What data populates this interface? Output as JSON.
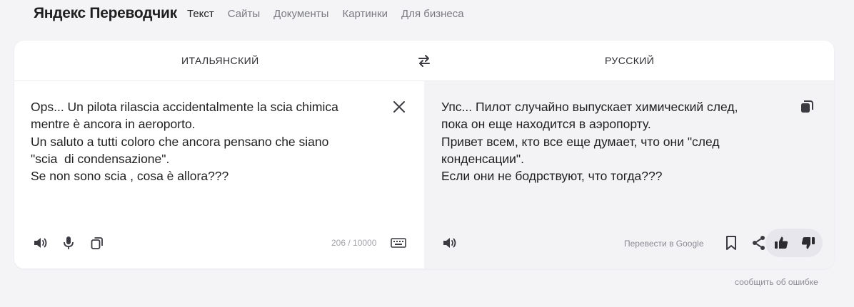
{
  "header": {
    "logo": "Яндекс Переводчик",
    "nav": [
      {
        "label": "Текст",
        "active": true
      },
      {
        "label": "Сайты",
        "active": false
      },
      {
        "label": "Документы",
        "active": false
      },
      {
        "label": "Картинки",
        "active": false
      },
      {
        "label": "Для бизнеса",
        "active": false
      }
    ]
  },
  "languages": {
    "source": "ИТАЛЬЯНСКИЙ",
    "target": "РУССКИЙ",
    "swap_icon": "swap-arrows-icon"
  },
  "source": {
    "text": "Ops... Un pilota rilascia accidentalmente la scia chimica\nmentre è ancora in aeroporto.\nUn saluto a tutti coloro che ancora pensano che siano\n\"scia  di condensazione\".\nSe non sono scia , cosa è allora???",
    "counter": "206 / 10000",
    "icons": [
      "close-icon",
      "speaker-icon",
      "microphone-icon",
      "copy-icon",
      "keyboard-icon"
    ]
  },
  "target": {
    "text": "Упс... Пилот случайно выпускает химический след,\nпока он еще находится в аэропорту.\nПривет всем, кто все еще думает, что они \"след\nконденсации\".\nЕсли они не бодрствуют, что тогда???",
    "google_link": "Перевести в Google",
    "icons": [
      "copy-icon",
      "speaker-icon",
      "bookmark-icon",
      "share-icon",
      "thumbs-up-icon",
      "thumbs-down-icon"
    ]
  },
  "footer": {
    "report_link": "сообщить об ошибке"
  },
  "colors": {
    "background": "#f4f4f7",
    "card": "#ffffff",
    "translation_pane": "#f3f3f6",
    "text": "#1f1f1f",
    "muted": "#7a7a82"
  }
}
